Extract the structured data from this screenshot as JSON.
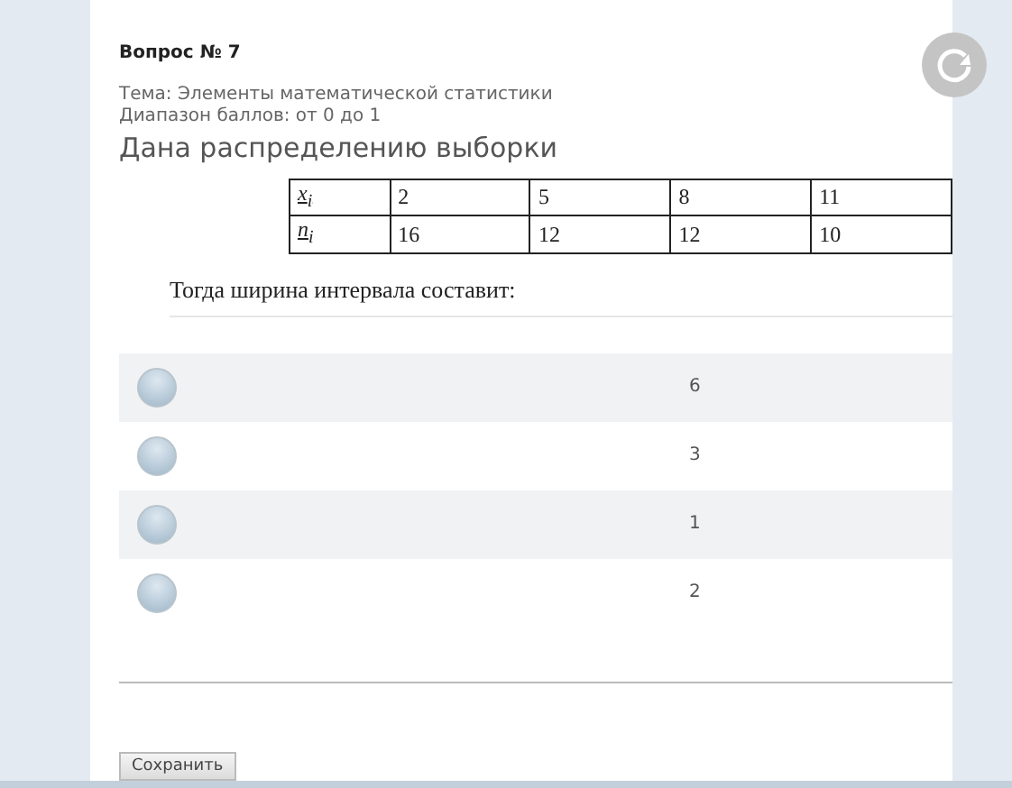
{
  "question": {
    "number": "Вопрос № 7",
    "topic": "Тема: Элементы математической статистики",
    "range": "Диапазон баллов: от 0 до 1",
    "title": "Дана распределению выборки",
    "table": [
      [
        "x$_{i}$",
        "2",
        "5",
        "8",
        "11"
      ],
      [
        "n$_{i}$",
        "16",
        "12",
        "12",
        "10"
      ]
    ],
    "prompt": "Тогда ширина интервала составит:"
  },
  "options": [
    {
      "label": "6",
      "selected": false
    },
    {
      "label": "3",
      "selected": false
    },
    {
      "label": "1",
      "selected": false
    },
    {
      "label": "2",
      "selected": false
    }
  ],
  "save_button": "Сохранить"
}
